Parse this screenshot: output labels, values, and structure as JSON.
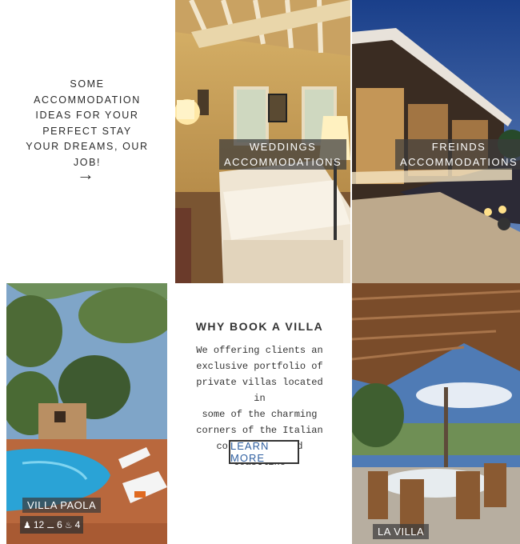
{
  "intro": {
    "line1": "SOME ACCOMMODATION",
    "line2": "IDEAS FOR YOUR",
    "line3": "PERFECT STAY",
    "line4": "YOUR DREAMS, OUR",
    "line5": "JOB!",
    "arrow": "→"
  },
  "tiles": {
    "weddings": {
      "line1": "WEDDINGS",
      "line2": "ACCOMMODATIONS"
    },
    "friends": {
      "line1": "FREINDS",
      "line2": "ACCOMMODATIONS"
    },
    "villa_paola": {
      "name": "VILLA PAOLA",
      "guests": "12",
      "beds": "6",
      "baths": "4"
    },
    "la_villa": {
      "name": "LA VILLA"
    }
  },
  "why": {
    "title": "WHY BOOK A VILLA",
    "lines": [
      "We offering clients an",
      "exclusive portfolio of",
      "private villas located in",
      "some of the charming",
      "corners of the Italian",
      "countryside and coastline"
    ],
    "button": "LEARN MORE"
  },
  "icons": [
    "arrow-right-icon",
    "guests-icon",
    "bed-icon",
    "bath-icon"
  ],
  "colors": {
    "link": "#2f5fa0",
    "caption_bg": "#3c3c3c"
  }
}
